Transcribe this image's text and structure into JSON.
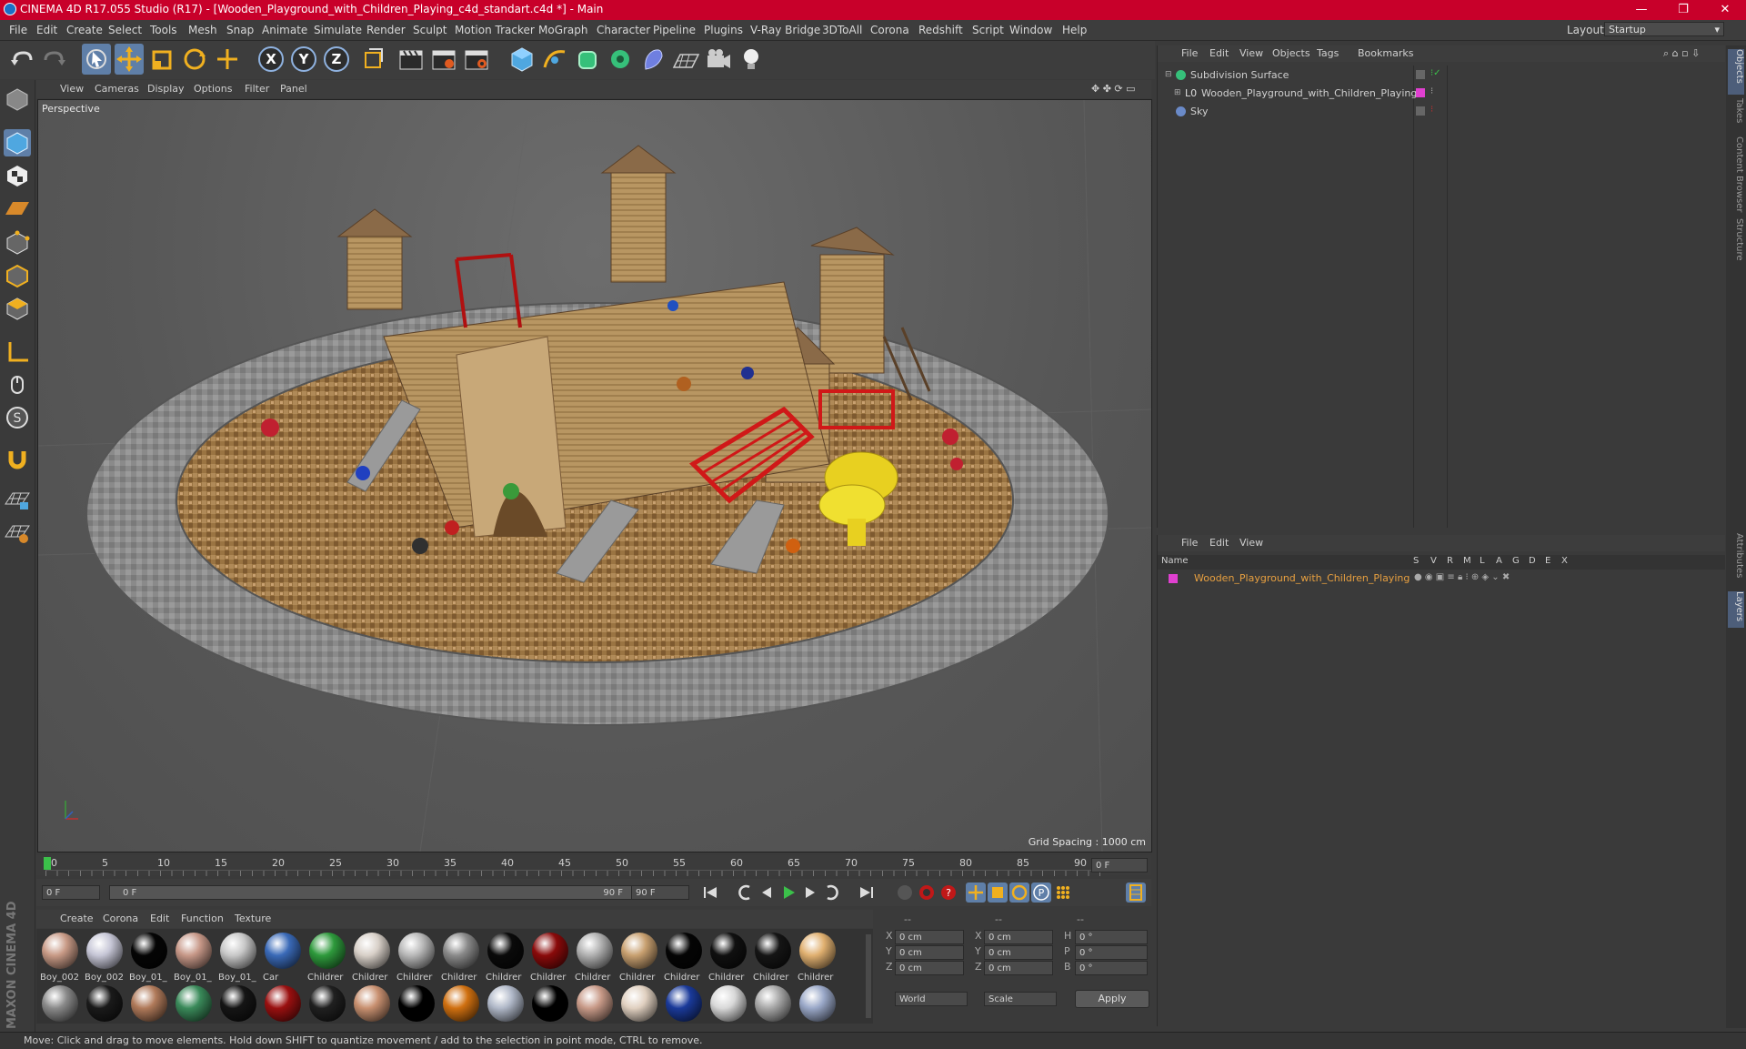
{
  "title": "CINEMA 4D R17.055 Studio (R17) - [Wooden_Playground_with_Children_Playing_c4d_standart.c4d *] - Main",
  "window_controls": {
    "minimize": "—",
    "maximize": "❐",
    "close": "✕"
  },
  "menu": [
    "File",
    "Edit",
    "Create",
    "Select",
    "Tools",
    "Mesh",
    "Snap",
    "Animate",
    "Simulate",
    "Render",
    "Sculpt",
    "Motion Tracker",
    "MoGraph",
    "Character",
    "Pipeline",
    "Plugins",
    "V-Ray Bridge",
    "3DToAll",
    "Corona",
    "Redshift",
    "Script",
    "Window",
    "Help"
  ],
  "layout": {
    "label": "Layout:",
    "value": "Startup"
  },
  "axes": {
    "x": "X",
    "y": "Y",
    "z": "Z"
  },
  "viewport": {
    "menu": [
      "View",
      "Cameras",
      "Display",
      "Options",
      "Filter",
      "Panel"
    ],
    "label": "Perspective",
    "grid_spacing": "Grid Spacing : 1000 cm"
  },
  "timeline": {
    "ticks": [
      "0",
      "5",
      "10",
      "15",
      "20",
      "25",
      "30",
      "35",
      "40",
      "45",
      "50",
      "55",
      "60",
      "65",
      "70",
      "75",
      "80",
      "85",
      "90"
    ],
    "end_field": "0 F"
  },
  "transport": {
    "start": "0 F",
    "range_start": "0 F",
    "range_end": "90 F",
    "end": "90 F"
  },
  "materials": {
    "menu": [
      "Create",
      "Corona",
      "Edit",
      "Function",
      "Texture"
    ],
    "row1": [
      {
        "label": "Boy_002",
        "color": "#c89a86"
      },
      {
        "label": "Boy_002",
        "color": "#c6c6d6"
      },
      {
        "label": "Boy_01_",
        "color": "#050505"
      },
      {
        "label": "Boy_01_",
        "color": "#c79888"
      },
      {
        "label": "Boy_01_",
        "color": "#c8c8c8"
      },
      {
        "label": "Car",
        "color": "#3a6ab8"
      },
      {
        "label": "Childrer",
        "color": "#2e9a3c"
      },
      {
        "label": "Childrer",
        "color": "#d8d0c8"
      },
      {
        "label": "Childrer",
        "color": "#b8b8b8"
      },
      {
        "label": "Childrer",
        "color": "#8a8a8a"
      },
      {
        "label": "Childrer",
        "color": "#0a0a0a"
      },
      {
        "label": "Childrer",
        "color": "#8a0a0a"
      },
      {
        "label": "Childrer",
        "color": "#b0b0b0"
      },
      {
        "label": "Childrer",
        "color": "#c8a070"
      },
      {
        "label": "Childrer",
        "color": "#050505"
      },
      {
        "label": "Childrer",
        "color": "#101010"
      },
      {
        "label": "Childrer",
        "color": "#151515"
      },
      {
        "label": "Childrer",
        "color": "#e0b070"
      }
    ],
    "row2": [
      {
        "color": "#8a8a8a"
      },
      {
        "color": "#1a1a1a"
      },
      {
        "color": "#b07a5a"
      },
      {
        "color": "#3a8a5a"
      },
      {
        "color": "#151515"
      },
      {
        "color": "#9a1010"
      },
      {
        "color": "#202020"
      },
      {
        "color": "#c89070"
      },
      {
        "color": "#000000"
      },
      {
        "color": "#d07010"
      },
      {
        "color": "#b0b8c8"
      },
      {
        "color": "#000000"
      },
      {
        "color": "#c89a88"
      },
      {
        "color": "#e0d0c0"
      },
      {
        "color": "#1a3a9a"
      },
      {
        "color": "#d8d8d8"
      },
      {
        "color": "#a8a8a8"
      },
      {
        "color": "#9aa8c8"
      }
    ]
  },
  "coords": {
    "header": [
      "--",
      "--",
      "--"
    ],
    "rows": [
      {
        "a": "X",
        "av": "0 cm",
        "b": "X",
        "bv": "0 cm",
        "c": "H",
        "cv": "0 °"
      },
      {
        "a": "Y",
        "av": "0 cm",
        "b": "Y",
        "bv": "0 cm",
        "c": "P",
        "cv": "0 °"
      },
      {
        "a": "Z",
        "av": "0 cm",
        "b": "Z",
        "bv": "0 cm",
        "c": "B",
        "cv": "0 °"
      }
    ],
    "world": "World",
    "scale": "Scale",
    "apply": "Apply"
  },
  "object_manager": {
    "menu": [
      "File",
      "Edit",
      "View",
      "Objects",
      "Tags",
      "Bookmarks"
    ],
    "objects": [
      {
        "name": "Subdivision Surface",
        "color": "#cfcfcf"
      },
      {
        "name": "Wooden_Playground_with_Children_Playing",
        "color": "#cfcfcf"
      },
      {
        "name": "Sky",
        "color": "#cfcfcf"
      }
    ]
  },
  "layer_manager": {
    "menu": [
      "File",
      "Edit",
      "View"
    ],
    "columns": [
      "Name",
      "S",
      "V",
      "R",
      "M",
      "L",
      "A",
      "G",
      "D",
      "E",
      "X"
    ],
    "layer": "Wooden_Playground_with_Children_Playing",
    "layer_color": "#e8a040"
  },
  "right_tabs": [
    "Objects",
    "Takes",
    "Content Browser",
    "Structure",
    "Attributes",
    "Layers"
  ],
  "status": "Move: Click and drag to move elements. Hold down SHIFT to quantize movement / add to the selection in point mode, CTRL to remove.",
  "brand": "MAXON CINEMA 4D"
}
